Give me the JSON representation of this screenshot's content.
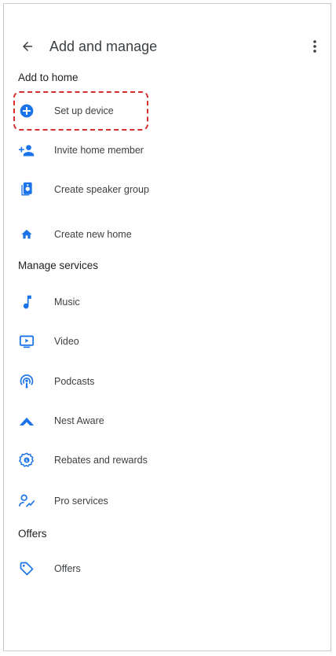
{
  "header": {
    "title": "Add and manage",
    "back_icon": "arrow-back-icon",
    "overflow_icon": "more-vert-icon"
  },
  "sections": {
    "add_to_home": {
      "title": "Add to home",
      "items": [
        {
          "label": "Set up device",
          "icon": "add-circle-icon"
        },
        {
          "label": "Invite home member",
          "icon": "person-add-icon"
        },
        {
          "label": "Create speaker group",
          "icon": "speaker-group-icon"
        },
        {
          "label": "Create new home",
          "icon": "home-icon"
        }
      ]
    },
    "manage_services": {
      "title": "Manage services",
      "items": [
        {
          "label": "Music",
          "icon": "music-note-icon"
        },
        {
          "label": "Video",
          "icon": "video-icon"
        },
        {
          "label": "Podcasts",
          "icon": "podcasts-icon"
        },
        {
          "label": "Nest Aware",
          "icon": "nest-aware-icon"
        },
        {
          "label": "Rebates and rewards",
          "icon": "rewards-icon"
        },
        {
          "label": "Pro services",
          "icon": "pro-services-icon"
        }
      ]
    },
    "offers": {
      "title": "Offers",
      "items": [
        {
          "label": "Offers",
          "icon": "tag-icon"
        }
      ]
    }
  },
  "colors": {
    "accent": "#1a73e8",
    "highlight": "#d32f2f",
    "text": "#202124"
  }
}
